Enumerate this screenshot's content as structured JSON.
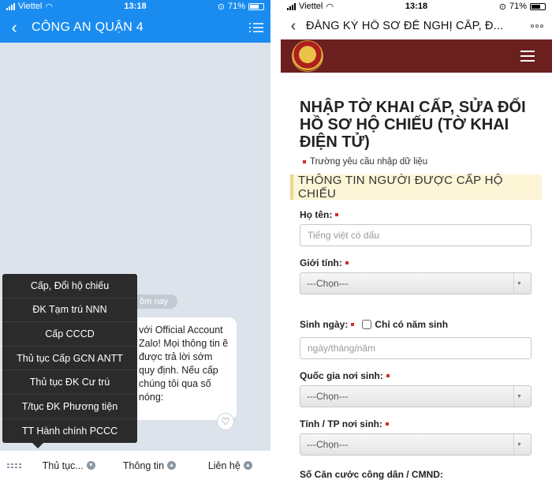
{
  "left": {
    "status": {
      "carrier": "Viettel",
      "time": "13:18",
      "battery": "71%"
    },
    "header": {
      "title": "CÔNG AN QUẬN 4"
    },
    "time_chip": "ôm nay",
    "bubble_text": "với Official Account Zalo! Mọi thông tin ẽ được trả lời sớm quy định. Nếu cấp chúng tôi qua số nóng:",
    "menu": [
      "Cấp, Đổi hộ chiếu",
      "ĐK Tạm trú NNN",
      "Cấp CCCD",
      "Thủ tục Cấp GCN ANTT",
      "Thủ tục ĐK Cư trú",
      "T/tục ĐK Phương tiện",
      "TT Hành chính PCCC"
    ],
    "bottom_tabs": [
      "Thủ tục...",
      "Thông tin",
      "Liên hệ"
    ],
    "colors": {
      "header": "#1a8cf0",
      "menu_bg": "#2b2b2b"
    }
  },
  "right": {
    "status": {
      "carrier": "Viettel",
      "time": "13:18",
      "battery": "71%"
    },
    "header": {
      "title": "ĐĂNG KÝ HỒ SƠ ĐỀ NGHỊ CẤP, Đ..."
    },
    "page_title": "NHẬP TỜ KHAI CẤP, SỬA ĐỔI HỒ SƠ HỘ CHIẾU (TỜ KHAI ĐIỆN TỬ)",
    "required_note": "Trường yêu cầu nhập dữ liệu",
    "section_title": "THÔNG TIN NGƯỜI ĐƯỢC CẤP HỘ CHIẾU",
    "fields": {
      "name_label": "Họ tên:",
      "name_placeholder": "Tiếng việt có dấu",
      "gender_label": "Giới tính:",
      "gender_value": "---Chọn---",
      "dob_label": "Sinh ngày:",
      "dob_checkbox_label": "Chỉ có năm sinh",
      "dob_placeholder": "ngày/tháng/năm",
      "birth_country_label": "Quốc gia nơi sinh:",
      "birth_country_value": "---Chọn---",
      "birth_province_label": "Tỉnh / TP nơi sinh:",
      "birth_province_value": "---Chọn---",
      "id_label": "Số Căn cước công dân / CMND:"
    },
    "colors": {
      "site_bar": "#6b1f1f",
      "section_band": "#fcf5d6",
      "required": "#d02b2b"
    }
  }
}
